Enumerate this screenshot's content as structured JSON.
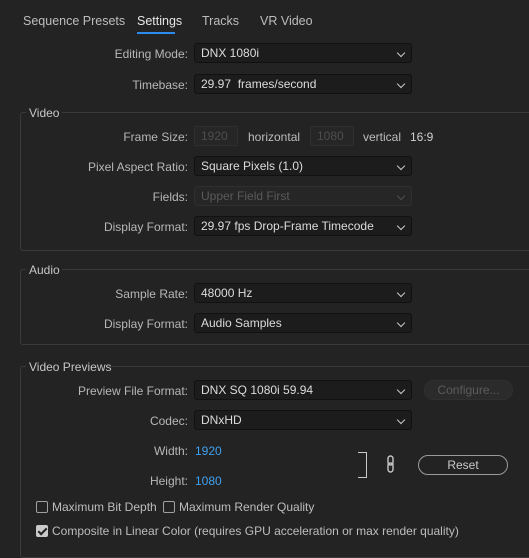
{
  "tabs": [
    {
      "label": "Sequence Presets"
    },
    {
      "label": "Settings"
    },
    {
      "label": "Tracks"
    },
    {
      "label": "VR Video"
    }
  ],
  "general": {
    "editing_mode_label": "Editing Mode:",
    "editing_mode_value": "DNX 1080i",
    "timebase_label": "Timebase:",
    "timebase_value": "29.97  frames/second"
  },
  "video": {
    "title": "Video",
    "frame_size_label": "Frame Size:",
    "frame_width": "1920",
    "horizontal_label": "horizontal",
    "frame_height": "1080",
    "vertical_label": "vertical",
    "aspect": "16:9",
    "pixel_aspect_label": "Pixel Aspect Ratio:",
    "pixel_aspect_value": "Square Pixels (1.0)",
    "fields_label": "Fields:",
    "fields_value": "Upper Field First",
    "display_format_label": "Display Format:",
    "display_format_value": "29.97 fps Drop-Frame Timecode"
  },
  "audio": {
    "title": "Audio",
    "sample_rate_label": "Sample Rate:",
    "sample_rate_value": "48000 Hz",
    "display_format_label": "Display Format:",
    "display_format_value": "Audio Samples"
  },
  "previews": {
    "title": "Video Previews",
    "preview_format_label": "Preview File Format:",
    "preview_format_value": "DNX SQ 1080i 59.94",
    "configure_label": "Configure...",
    "codec_label": "Codec:",
    "codec_value": "DNxHD",
    "width_label": "Width:",
    "width_value": "1920",
    "height_label": "Height:",
    "height_value": "1080",
    "reset_label": "Reset"
  },
  "options": {
    "max_bit_depth": {
      "label": "Maximum Bit Depth",
      "checked": false
    },
    "max_render_quality": {
      "label": "Maximum Render Quality",
      "checked": false
    },
    "linear_color": {
      "label": "Composite in Linear Color (requires GPU acceleration or max render quality)",
      "checked": true
    }
  }
}
